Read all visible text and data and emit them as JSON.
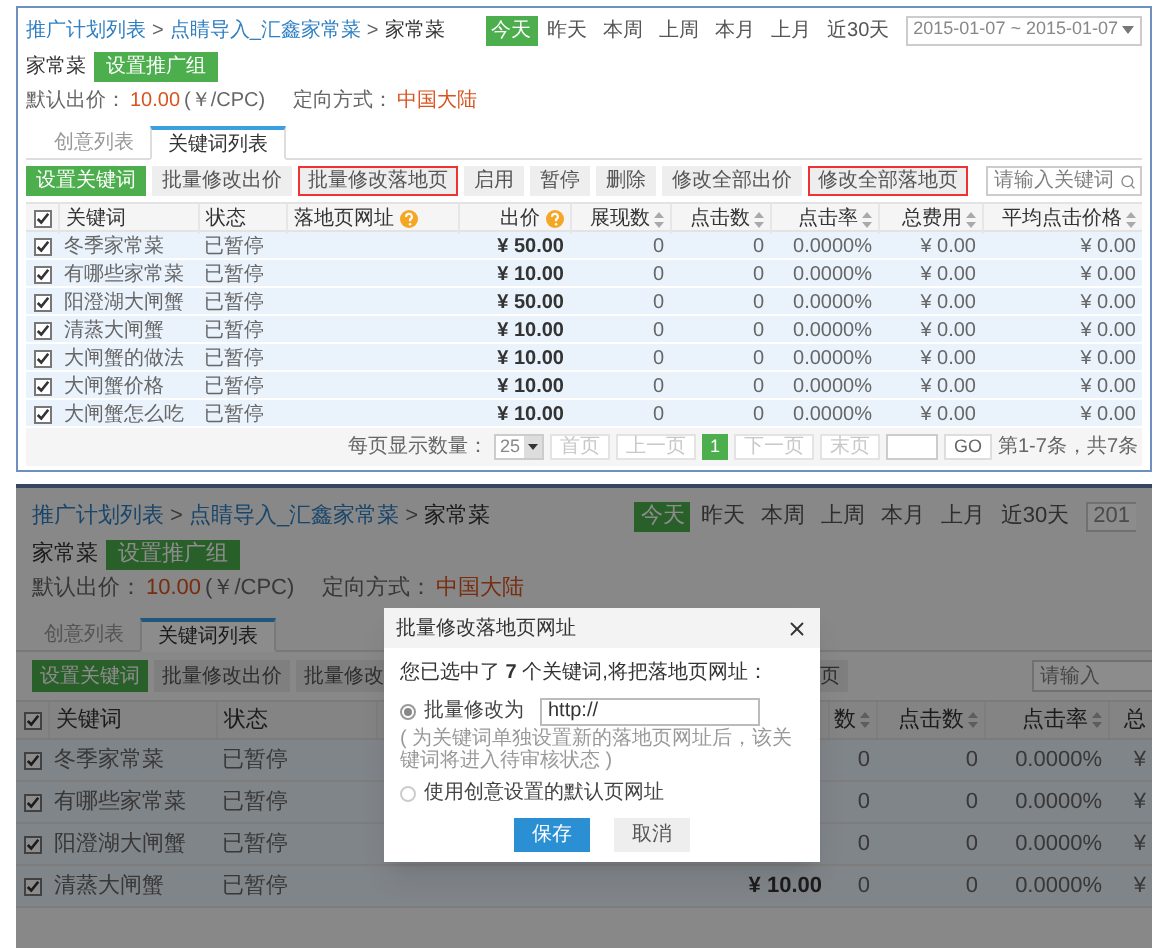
{
  "top_screen": {
    "breadcrumb": [
      {
        "label": "推广计划列表",
        "kind": "link",
        "separator": ">"
      },
      {
        "label": "点睛导入_汇鑫家常菜",
        "kind": "link",
        "separator": ">"
      },
      {
        "label": "家常菜",
        "kind": "current"
      }
    ],
    "date_ranges": [
      {
        "label": "今天",
        "selected": true
      },
      {
        "label": "昨天",
        "selected": false
      },
      {
        "label": "本周",
        "selected": false
      },
      {
        "label": "上周",
        "selected": false
      },
      {
        "label": "本月",
        "selected": false
      },
      {
        "label": "上月",
        "selected": false
      },
      {
        "label": "近30天",
        "selected": false
      }
    ],
    "date_field": "2015-01-07 ~ 2015-01-07",
    "group": {
      "name": "家常菜",
      "button": "设置推广组"
    },
    "bid": {
      "label": "默认出价：",
      "value": "10.00",
      "unit": "(￥/CPC)"
    },
    "targeting": {
      "label": "定向方式：",
      "value": "中国大陆"
    },
    "tabs": [
      {
        "label": "创意列表",
        "selected": false
      },
      {
        "label": "关键词列表",
        "selected": true
      }
    ],
    "toolbar": [
      {
        "label": "设置关键词",
        "kind": "primary",
        "highlighted": false
      },
      {
        "label": "批量修改出价",
        "kind": "default",
        "highlighted": false
      },
      {
        "label": "批量修改落地页",
        "kind": "default",
        "highlighted": true
      },
      {
        "label": "启用",
        "kind": "default",
        "highlighted": false
      },
      {
        "label": "暂停",
        "kind": "default",
        "highlighted": false
      },
      {
        "label": "删除",
        "kind": "default",
        "highlighted": false
      },
      {
        "label": "修改全部出价",
        "kind": "default",
        "highlighted": false
      },
      {
        "label": "修改全部落地页",
        "kind": "default",
        "highlighted": true
      }
    ],
    "search": {
      "placeholder": "请输入关键词"
    },
    "table": {
      "header_checked": true,
      "columns": [
        {
          "label": "关键词",
          "kind": "text"
        },
        {
          "label": "状态",
          "kind": "text"
        },
        {
          "label": "落地页网址",
          "kind": "text-help"
        },
        {
          "label": "出价",
          "kind": "number-help"
        },
        {
          "label": "展现数",
          "kind": "number-sort"
        },
        {
          "label": "点击数",
          "kind": "number-sort"
        },
        {
          "label": "点击率",
          "kind": "number-sort"
        },
        {
          "label": "总费用",
          "kind": "number-sort"
        },
        {
          "label": "平均点击价格",
          "kind": "number-sort"
        }
      ],
      "rows": [
        {
          "checked": true,
          "keyword": "冬季家常菜",
          "status": "已暂停",
          "price": "¥ 50.00",
          "impressions": "0",
          "clicks": "0",
          "ctr": "0.0000%",
          "cost": "¥ 0.00",
          "avg_cpc": "¥ 0.00"
        },
        {
          "checked": true,
          "keyword": "有哪些家常菜",
          "status": "已暂停",
          "price": "¥ 10.00",
          "impressions": "0",
          "clicks": "0",
          "ctr": "0.0000%",
          "cost": "¥ 0.00",
          "avg_cpc": "¥ 0.00"
        },
        {
          "checked": true,
          "keyword": "阳澄湖大闸蟹",
          "status": "已暂停",
          "price": "¥ 50.00",
          "impressions": "0",
          "clicks": "0",
          "ctr": "0.0000%",
          "cost": "¥ 0.00",
          "avg_cpc": "¥ 0.00"
        },
        {
          "checked": true,
          "keyword": "清蒸大闸蟹",
          "status": "已暂停",
          "price": "¥ 10.00",
          "impressions": "0",
          "clicks": "0",
          "ctr": "0.0000%",
          "cost": "¥ 0.00",
          "avg_cpc": "¥ 0.00"
        },
        {
          "checked": true,
          "keyword": "大闸蟹的做法",
          "status": "已暂停",
          "price": "¥ 10.00",
          "impressions": "0",
          "clicks": "0",
          "ctr": "0.0000%",
          "cost": "¥ 0.00",
          "avg_cpc": "¥ 0.00"
        },
        {
          "checked": true,
          "keyword": "大闸蟹价格",
          "status": "已暂停",
          "price": "¥ 10.00",
          "impressions": "0",
          "clicks": "0",
          "ctr": "0.0000%",
          "cost": "¥ 0.00",
          "avg_cpc": "¥ 0.00"
        },
        {
          "checked": true,
          "keyword": "大闸蟹怎么吃",
          "status": "已暂停",
          "price": "¥ 10.00",
          "impressions": "0",
          "clicks": "0",
          "ctr": "0.0000%",
          "cost": "¥ 0.00",
          "avg_cpc": "¥ 0.00"
        }
      ]
    },
    "pagination": {
      "page_size_label": "每页显示数量：",
      "page_size": "25",
      "buttons": [
        {
          "label": "首页",
          "kind": "nav",
          "disabled": true
        },
        {
          "label": "上一页",
          "kind": "nav",
          "disabled": true
        },
        {
          "label": "1",
          "kind": "page",
          "selected": true
        },
        {
          "label": "下一页",
          "kind": "nav",
          "disabled": true
        },
        {
          "label": "末页",
          "kind": "nav",
          "disabled": true
        }
      ],
      "go": "GO",
      "summary": "第1-7条，共7条"
    }
  },
  "bottom_screen": {
    "breadcrumb": [
      {
        "label": "推广计划列表",
        "kind": "link",
        "separator": ">"
      },
      {
        "label": "点睛导入_汇鑫家常菜",
        "kind": "link",
        "separator": ">"
      },
      {
        "label": "家常菜",
        "kind": "current"
      }
    ],
    "date_ranges": [
      {
        "label": "今天",
        "selected": true
      },
      {
        "label": "昨天",
        "selected": false
      },
      {
        "label": "本周",
        "selected": false
      },
      {
        "label": "上周",
        "selected": false
      },
      {
        "label": "本月",
        "selected": false
      },
      {
        "label": "上月",
        "selected": false
      },
      {
        "label": "近30天",
        "selected": false
      }
    ],
    "date_field": "201",
    "group": {
      "name": "家常菜",
      "button": "设置推广组"
    },
    "bid": {
      "label": "默认出价：",
      "value": "10.00",
      "unit": "(￥/CPC)"
    },
    "targeting": {
      "label": "定向方式：",
      "value": "中国大陆"
    },
    "tabs": [
      {
        "label": "创意列表",
        "selected": false
      },
      {
        "label": "关键词列表",
        "selected": true
      }
    ],
    "toolbar": [
      {
        "label": "设置关键词",
        "kind": "primary"
      },
      {
        "label": "批量修改出价",
        "kind": "default"
      },
      {
        "label": "批量修改",
        "kind": "default"
      },
      {
        "label": "页",
        "kind": "fragment"
      }
    ],
    "search": {
      "placeholder": "请输入"
    },
    "table": {
      "header_checked": true,
      "columns": [
        {
          "label": "关键词",
          "kind": "text"
        },
        {
          "label": "状态",
          "kind": "text"
        },
        {
          "label": "数",
          "kind": "number-sort"
        },
        {
          "label": "点击数",
          "kind": "number-sort"
        },
        {
          "label": "点击率",
          "kind": "number-sort"
        },
        {
          "label": "总",
          "kind": "number"
        }
      ],
      "rows": [
        {
          "checked": true,
          "keyword": "冬季家常菜",
          "status": "已暂停",
          "impressions": "0",
          "clicks": "0",
          "ctr": "0.0000%",
          "cost": "¥"
        },
        {
          "checked": true,
          "keyword": "有哪些家常菜",
          "status": "已暂停",
          "impressions": "0",
          "clicks": "0",
          "ctr": "0.0000%",
          "cost": "¥"
        },
        {
          "checked": true,
          "keyword": "阳澄湖大闸蟹",
          "status": "已暂停",
          "impressions": "0",
          "clicks": "0",
          "ctr": "0.0000%",
          "cost": "¥"
        },
        {
          "checked": true,
          "keyword": "清蒸大闸蟹",
          "status": "已暂停",
          "price": "¥ 10.00",
          "impressions": "0",
          "clicks": "0",
          "ctr": "0.0000%",
          "cost": "¥"
        }
      ]
    },
    "dialog": {
      "title": "批量修改落地页网址",
      "intro": "您已选中了 **7** 个关键词,将把落地页网址：",
      "options": [
        {
          "label": "批量修改为",
          "selected": true,
          "kind": "input",
          "value": "http://",
          "hint": "( 为关键词单独设置新的落地页网址后，该关键词将进入待审核状态 )"
        },
        {
          "label": "使用创意设置的默认页网址",
          "selected": false,
          "kind": "plain"
        }
      ],
      "buttons": [
        {
          "label": "保存",
          "kind": "primary"
        },
        {
          "label": "取消",
          "kind": "default"
        }
      ]
    }
  }
}
